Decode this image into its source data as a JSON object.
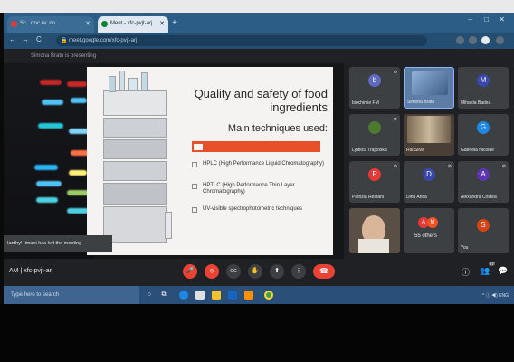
{
  "browser": {
    "tabs": [
      {
        "label": "Sc.. rtoc ra: no..."
      },
      {
        "label": "Meet - xfc-pvjt-arj"
      }
    ],
    "new_tab": "+",
    "win_min": "–",
    "win_max": "□",
    "win_close": "✕",
    "back": "←",
    "forward": "→",
    "reload": "C",
    "url": "meet.google.com/xfc-pvjt-arj"
  },
  "meeting": {
    "presenting_text": "Simona Bratu is presenting",
    "left_toast": "Ianthy! Iimani has left the meeting",
    "meeting_id": "AM  |  xfc-pvjt-arj",
    "slide": {
      "title": "Quality and safety of food ingredients",
      "subtitle": "Main techniques used:",
      "bullets": [
        "HPLC (High Performance Liquid Chromatography)",
        "HPTLC (High Performance Thin Layer Chromatography)",
        "UV-visible spectrophotometric techniques"
      ]
    },
    "participants": [
      {
        "name": "biochimie FM",
        "initial": "b",
        "color": "#5c6bc0"
      },
      {
        "name": "Simona Bratu",
        "initial": "",
        "color": "#1a73e8"
      },
      {
        "name": "Mihaela Badea",
        "initial": "M",
        "color": "#3949ab"
      },
      {
        "name": "Ljubica Trajkoska",
        "initial": "",
        "color": "#4e7a2f"
      },
      {
        "name": "Rui Silva",
        "initial": "",
        "color": "#6d4c41"
      },
      {
        "name": "Gabriela Nicolae",
        "initial": "G",
        "color": "#1e88e5"
      },
      {
        "name": "Patrizia Restani",
        "initial": "P",
        "color": "#e53935"
      },
      {
        "name": "Dinu Anca",
        "initial": "D",
        "color": "#3949ab"
      },
      {
        "name": "Alexandra Cristea",
        "initial": "A",
        "color": "#5e35b1"
      },
      {
        "name": "You",
        "initial": "S",
        "color": "#d84315"
      }
    ],
    "others_label": "55 others",
    "others_avatars": [
      "A",
      "M"
    ],
    "controls": {
      "mic": "🎤",
      "cam": "⦸",
      "cc": "CC",
      "hand": "✋",
      "present": "⬆",
      "more": "⋮",
      "hangup": "☎"
    },
    "right_icons": {
      "info": "ⓘ",
      "people": "👥",
      "chat": "💬",
      "people_badge": "67"
    }
  },
  "taskbar": {
    "search_placeholder": "Type here to search",
    "tray_text": "^ ⓘ ◀) ENG"
  }
}
